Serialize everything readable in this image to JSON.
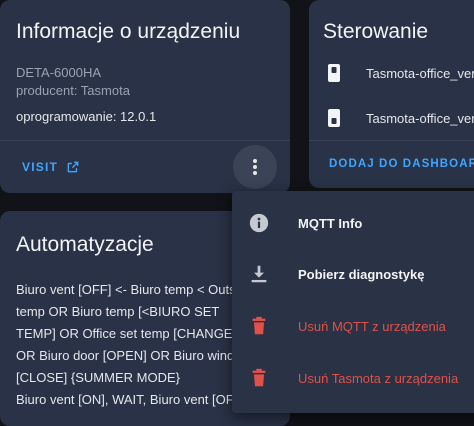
{
  "device_info": {
    "title": "Informacje o urządzeniu",
    "model": "DETA-6000HA",
    "manufacturer": "producent: Tasmota",
    "firmware": "oprogramowanie: 12.0.1",
    "visit_label": "VISIT"
  },
  "control": {
    "title": "Sterowanie",
    "entities": [
      {
        "name": "Tasmota-office_vent",
        "icon": "light-switch-icon"
      },
      {
        "name": "Tasmota-office_vent",
        "icon": "light-switch-icon"
      }
    ],
    "add_dashboard_label": "DODAJ DO DASHBOARDU"
  },
  "automations": {
    "title": "Automatyzacje",
    "lines": [
      "Biuro vent [OFF] <- Biuro temp < Outside",
      "temp OR Biuro temp [<BIURO SET",
      "TEMP] OR Office set temp [CHANGED]",
      "OR Biuro door [OPEN] OR Biuro window",
      "[CLOSE] {SUMMER MODE}",
      "Biuro vent [ON], WAIT, Biuro vent [OFF]"
    ]
  },
  "menu": {
    "items": [
      {
        "label": "MQTT Info",
        "icon": "info-icon",
        "danger": false
      },
      {
        "label": "Pobierz diagnostykę",
        "icon": "download-icon",
        "danger": false
      },
      {
        "label": "Usuń MQTT z urządzenia",
        "icon": "trash-icon",
        "danger": true
      },
      {
        "label": "Usuń Tasmota z urządzenia",
        "icon": "trash-icon",
        "danger": true
      }
    ]
  },
  "colors": {
    "accent": "#3ea6ff",
    "danger": "#e0514a",
    "card_bg": "#293246",
    "page_bg": "#111318"
  }
}
